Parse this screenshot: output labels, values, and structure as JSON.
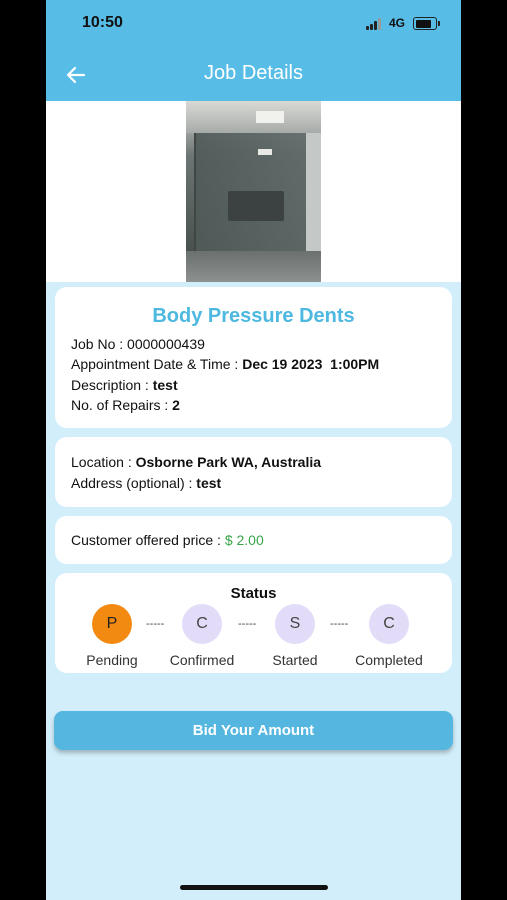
{
  "status_bar": {
    "time": "10:50",
    "network": "4G"
  },
  "app_bar": {
    "title": "Job Details",
    "back_icon": "arrow-left-icon"
  },
  "job": {
    "title": "Body Pressure Dents",
    "job_no_label": "Job No : ",
    "job_no_value": "0000000439",
    "appointment_label": "Appointment Date & Time : ",
    "appointment_value": "Dec 19 2023  1:00PM",
    "description_label": "Description : ",
    "description_value": "test",
    "repairs_label": "No. of Repairs : ",
    "repairs_value": "2"
  },
  "location": {
    "location_label": "Location : ",
    "location_value": "Osborne Park WA, Australia",
    "address_label": "Address (optional) : ",
    "address_value": "test"
  },
  "price": {
    "label": "Customer offered price : ",
    "value": "$ 2.00",
    "value_color": "#3aa54a"
  },
  "status": {
    "heading": "Status",
    "separator": "-----",
    "steps": [
      {
        "initial": "P",
        "label": "Pending",
        "active": true
      },
      {
        "initial": "C",
        "label": "Confirmed",
        "active": false
      },
      {
        "initial": "S",
        "label": "Started",
        "active": false
      },
      {
        "initial": "C",
        "label": "Completed",
        "active": false
      }
    ],
    "active_color": "#f28a12",
    "inactive_color": "#e3dcf8"
  },
  "actions": {
    "bid_button": "Bid Your Amount"
  },
  "colors": {
    "primary": "#57bde6",
    "background": "#d2eefa",
    "title_accent": "#4db8e0"
  }
}
